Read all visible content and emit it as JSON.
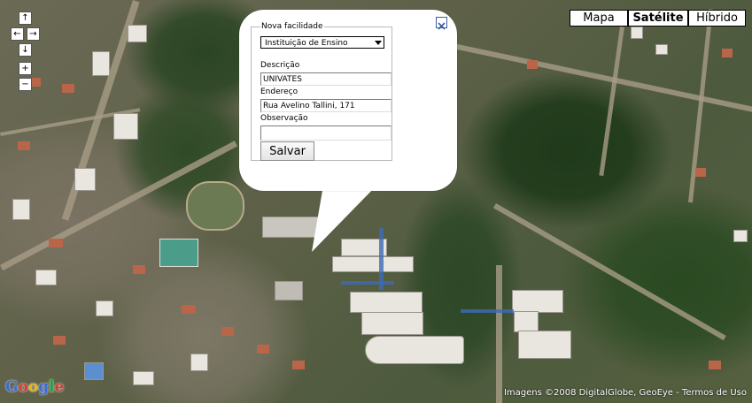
{
  "nav": {
    "pan_up": "↑",
    "pan_left": "←",
    "pan_right": "→",
    "pan_down": "↓",
    "zoom_in": "+",
    "zoom_out": "−"
  },
  "map_types": {
    "map": "Mapa",
    "satellite": "Satélite",
    "hybrid": "Híbrido",
    "selected": "Satélite"
  },
  "form": {
    "legend": "Nova facilidade",
    "type_selected": "Instituição de Ensino",
    "description_label": "Descrição",
    "description_value": "UNIVATES",
    "address_label": "Endereço",
    "address_value": "Rua Avelino Tallini, 171",
    "observation_label": "Observação",
    "observation_value": "",
    "save_label": "Salvar"
  },
  "logo": {
    "text": "Google",
    "colors": [
      "#3b6bd6",
      "#d63b2f",
      "#e8b717",
      "#3b6bd6",
      "#2e9e3f",
      "#d63b2f"
    ]
  },
  "attribution": {
    "imagery": "Imagens ©2008 DigitalGlobe, GeoEye",
    "separator": " - ",
    "terms": "Termos de Uso"
  }
}
